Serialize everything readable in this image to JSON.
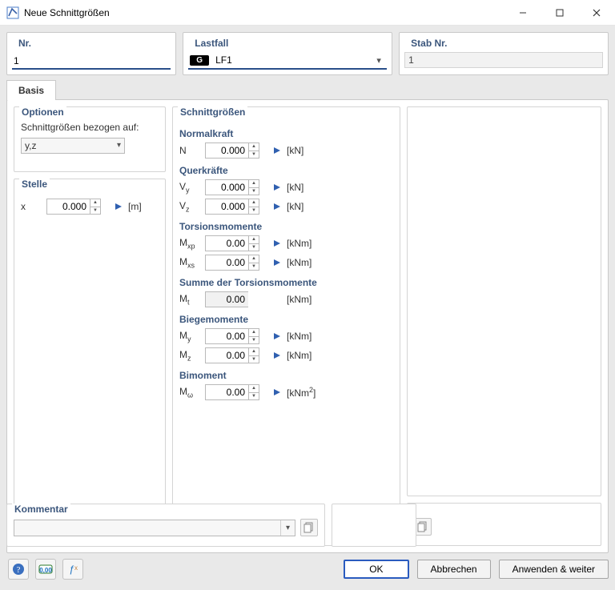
{
  "window": {
    "title": "Neue Schnittgrößen"
  },
  "top": {
    "nr": {
      "label": "Nr.",
      "value": "1"
    },
    "lastfall": {
      "label": "Lastfall",
      "badge": "G",
      "value": "LF1"
    },
    "stab": {
      "label": "Stab Nr.",
      "value": "1"
    }
  },
  "tabs": {
    "basis": "Basis"
  },
  "optionen": {
    "title": "Optionen",
    "bezogen_label": "Schnittgrößen bezogen auf:",
    "bezogen_value": "y,z"
  },
  "stelle": {
    "title": "Stelle",
    "x": {
      "label": "x",
      "value": "0.000",
      "unit": "[m]"
    }
  },
  "sg": {
    "title": "Schnittgrößen",
    "normalkraft": {
      "header": "Normalkraft",
      "N": {
        "label": "N",
        "value": "0.000",
        "unit": "[kN]"
      }
    },
    "querkraefte": {
      "header": "Querkräfte",
      "Vy": {
        "label": "V",
        "sub": "y",
        "value": "0.000",
        "unit": "[kN]"
      },
      "Vz": {
        "label": "V",
        "sub": "z",
        "value": "0.000",
        "unit": "[kN]"
      }
    },
    "torsion": {
      "header": "Torsionsmomente",
      "Mxp": {
        "label": "M",
        "sub": "xp",
        "value": "0.00",
        "unit": "[kNm]"
      },
      "Mxs": {
        "label": "M",
        "sub": "xs",
        "value": "0.00",
        "unit": "[kNm]"
      }
    },
    "summe_torsion": {
      "header": "Summe der Torsionsmomente",
      "Mt": {
        "label": "M",
        "sub": "t",
        "value": "0.00",
        "unit": "[kNm]"
      }
    },
    "biege": {
      "header": "Biegemomente",
      "My": {
        "label": "M",
        "sub": "y",
        "value": "0.00",
        "unit": "[kNm]"
      },
      "Mz": {
        "label": "M",
        "sub": "z",
        "value": "0.00",
        "unit": "[kNm]"
      }
    },
    "bimoment": {
      "header": "Bimoment",
      "Mw": {
        "label": "M",
        "sub": "ω",
        "value": "0.00",
        "unit_html": "[kNm",
        "unit_sup": "2",
        "unit_close": "]"
      }
    }
  },
  "kommentar": {
    "title": "Kommentar",
    "value": ""
  },
  "buttons": {
    "ok": "OK",
    "cancel": "Abbrechen",
    "apply": "Anwenden & weiter"
  }
}
